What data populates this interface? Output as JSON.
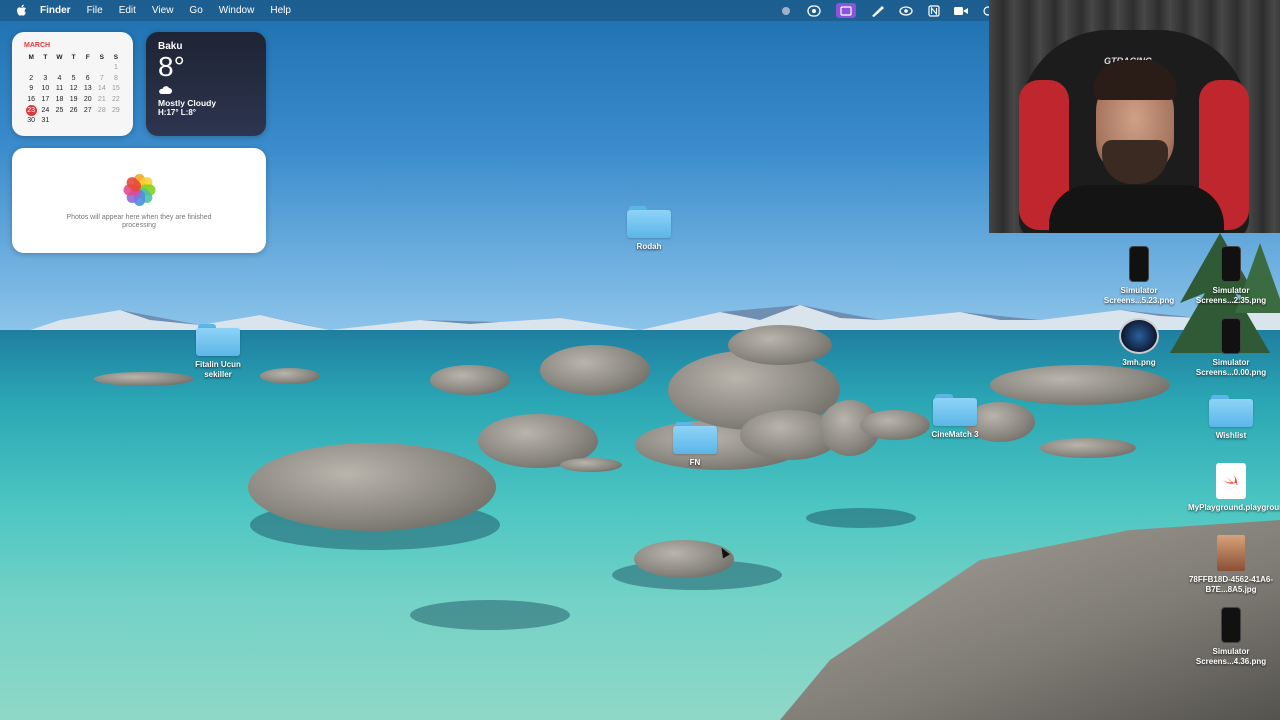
{
  "menubar": {
    "apple": "",
    "items": [
      "Finder",
      "File",
      "Edit",
      "View",
      "Go",
      "Window",
      "Help"
    ]
  },
  "calendar": {
    "month": "MARCH",
    "weekdays": [
      "M",
      "T",
      "W",
      "T",
      "F",
      "S",
      "S"
    ],
    "weeks": [
      [
        "",
        "",
        "",
        "",
        "",
        "",
        "1"
      ],
      [
        "2",
        "3",
        "4",
        "5",
        "6",
        "7",
        "8"
      ],
      [
        "9",
        "10",
        "11",
        "12",
        "13",
        "14",
        "15"
      ],
      [
        "16",
        "17",
        "18",
        "19",
        "20",
        "21",
        "22"
      ],
      [
        "23",
        "24",
        "25",
        "26",
        "27",
        "28",
        "29"
      ],
      [
        "30",
        "31",
        "",
        "",
        "",
        "",
        ""
      ]
    ],
    "today": "23",
    "accent": "#e0393d"
  },
  "weather": {
    "city": "Baku",
    "temp": "8°",
    "condition": "Mostly Cloudy",
    "hilo": "H:17° L:8°"
  },
  "photos_widget": {
    "message": "Photos will appear here when they are finished processing"
  },
  "desktop": {
    "folders": {
      "rodah": "Rodah",
      "fitalin": "Fitalin Ucun sekiller",
      "fn": "FN",
      "cinematch": "CineMatch 3",
      "wishlist": "Wishlist"
    },
    "files": {
      "sim1": "Simulator Screens...5.23.png",
      "sim2": "Simulator Screens...2.35.png",
      "mh": "3mh.png",
      "sim3": "Simulator Screens...0.00.png",
      "playground": "MyPlayground.playground",
      "jpg": "78FFB18D-4562-41A6-B7E...8A5.jpg",
      "sim4": "Simulator Screens...4.36.png"
    }
  },
  "webcam": {
    "chair_brand": "GTRACING"
  }
}
